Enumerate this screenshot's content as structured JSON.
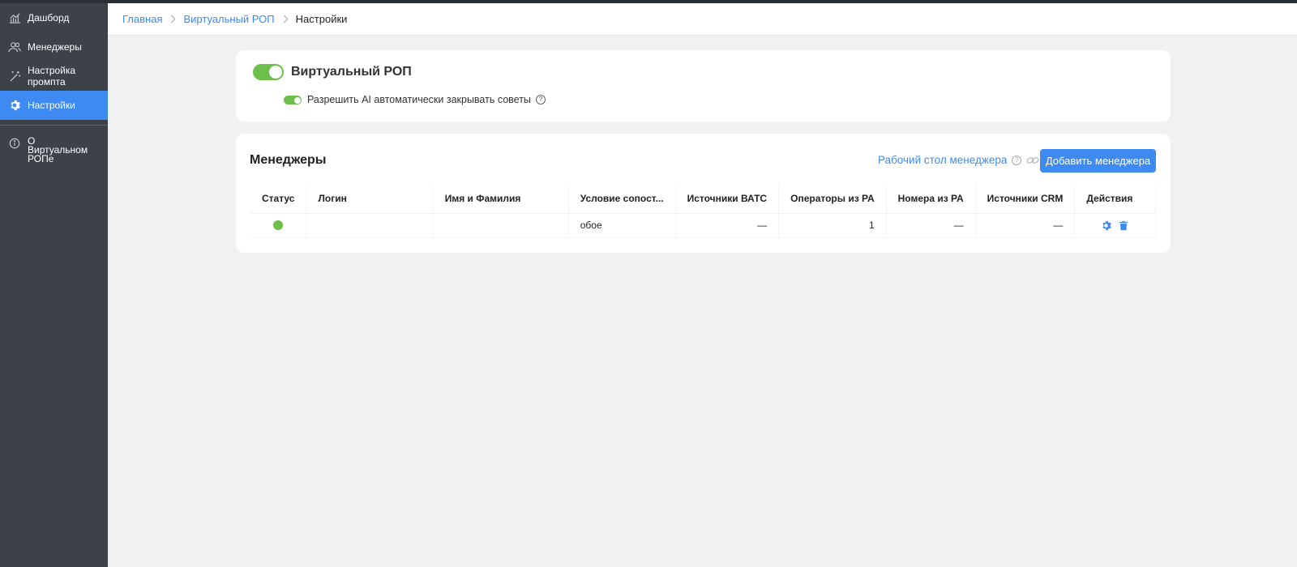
{
  "sidebar": {
    "items": [
      {
        "label": "Дашборд",
        "icon": "chart-icon"
      },
      {
        "label": "Менеджеры",
        "icon": "users-icon"
      },
      {
        "label": "Настройка промпта",
        "icon": "magic-wand-icon"
      },
      {
        "label": "Настройки",
        "icon": "gear-icon",
        "active": true
      },
      {
        "label": "О Виртуальном РОПе",
        "icon": "info-icon"
      }
    ]
  },
  "breadcrumb": {
    "home": "Главная",
    "section": "Виртуальный РОП",
    "current": "Настройки"
  },
  "virtual_rop": {
    "title": "Виртуальный РОП",
    "enabled": true,
    "auto_close_label": "Разрешить AI автоматически закрывать советы",
    "auto_close_enabled": true,
    "help_symbol": "?"
  },
  "managers": {
    "title": "Менеджеры",
    "desk_link": "Рабочий стол менеджера",
    "add_button": "Добавить менеджера",
    "columns": [
      "Статус",
      "Логин",
      "Имя и Фамилия",
      "Условие сопост...",
      "Источники ВАТС",
      "Операторы из РА",
      "Номера из РА",
      "Источники CRM",
      "Действия"
    ],
    "rows": [
      {
        "status": "active",
        "login": "",
        "name": "",
        "condition": "обое",
        "vats": "—",
        "ops": "1",
        "numbers": "—",
        "crm": "—"
      }
    ]
  },
  "colors": {
    "accent": "#3d8bf2",
    "toggle_on": "#6cc04a",
    "sidebar_bg": "#3d4148"
  }
}
